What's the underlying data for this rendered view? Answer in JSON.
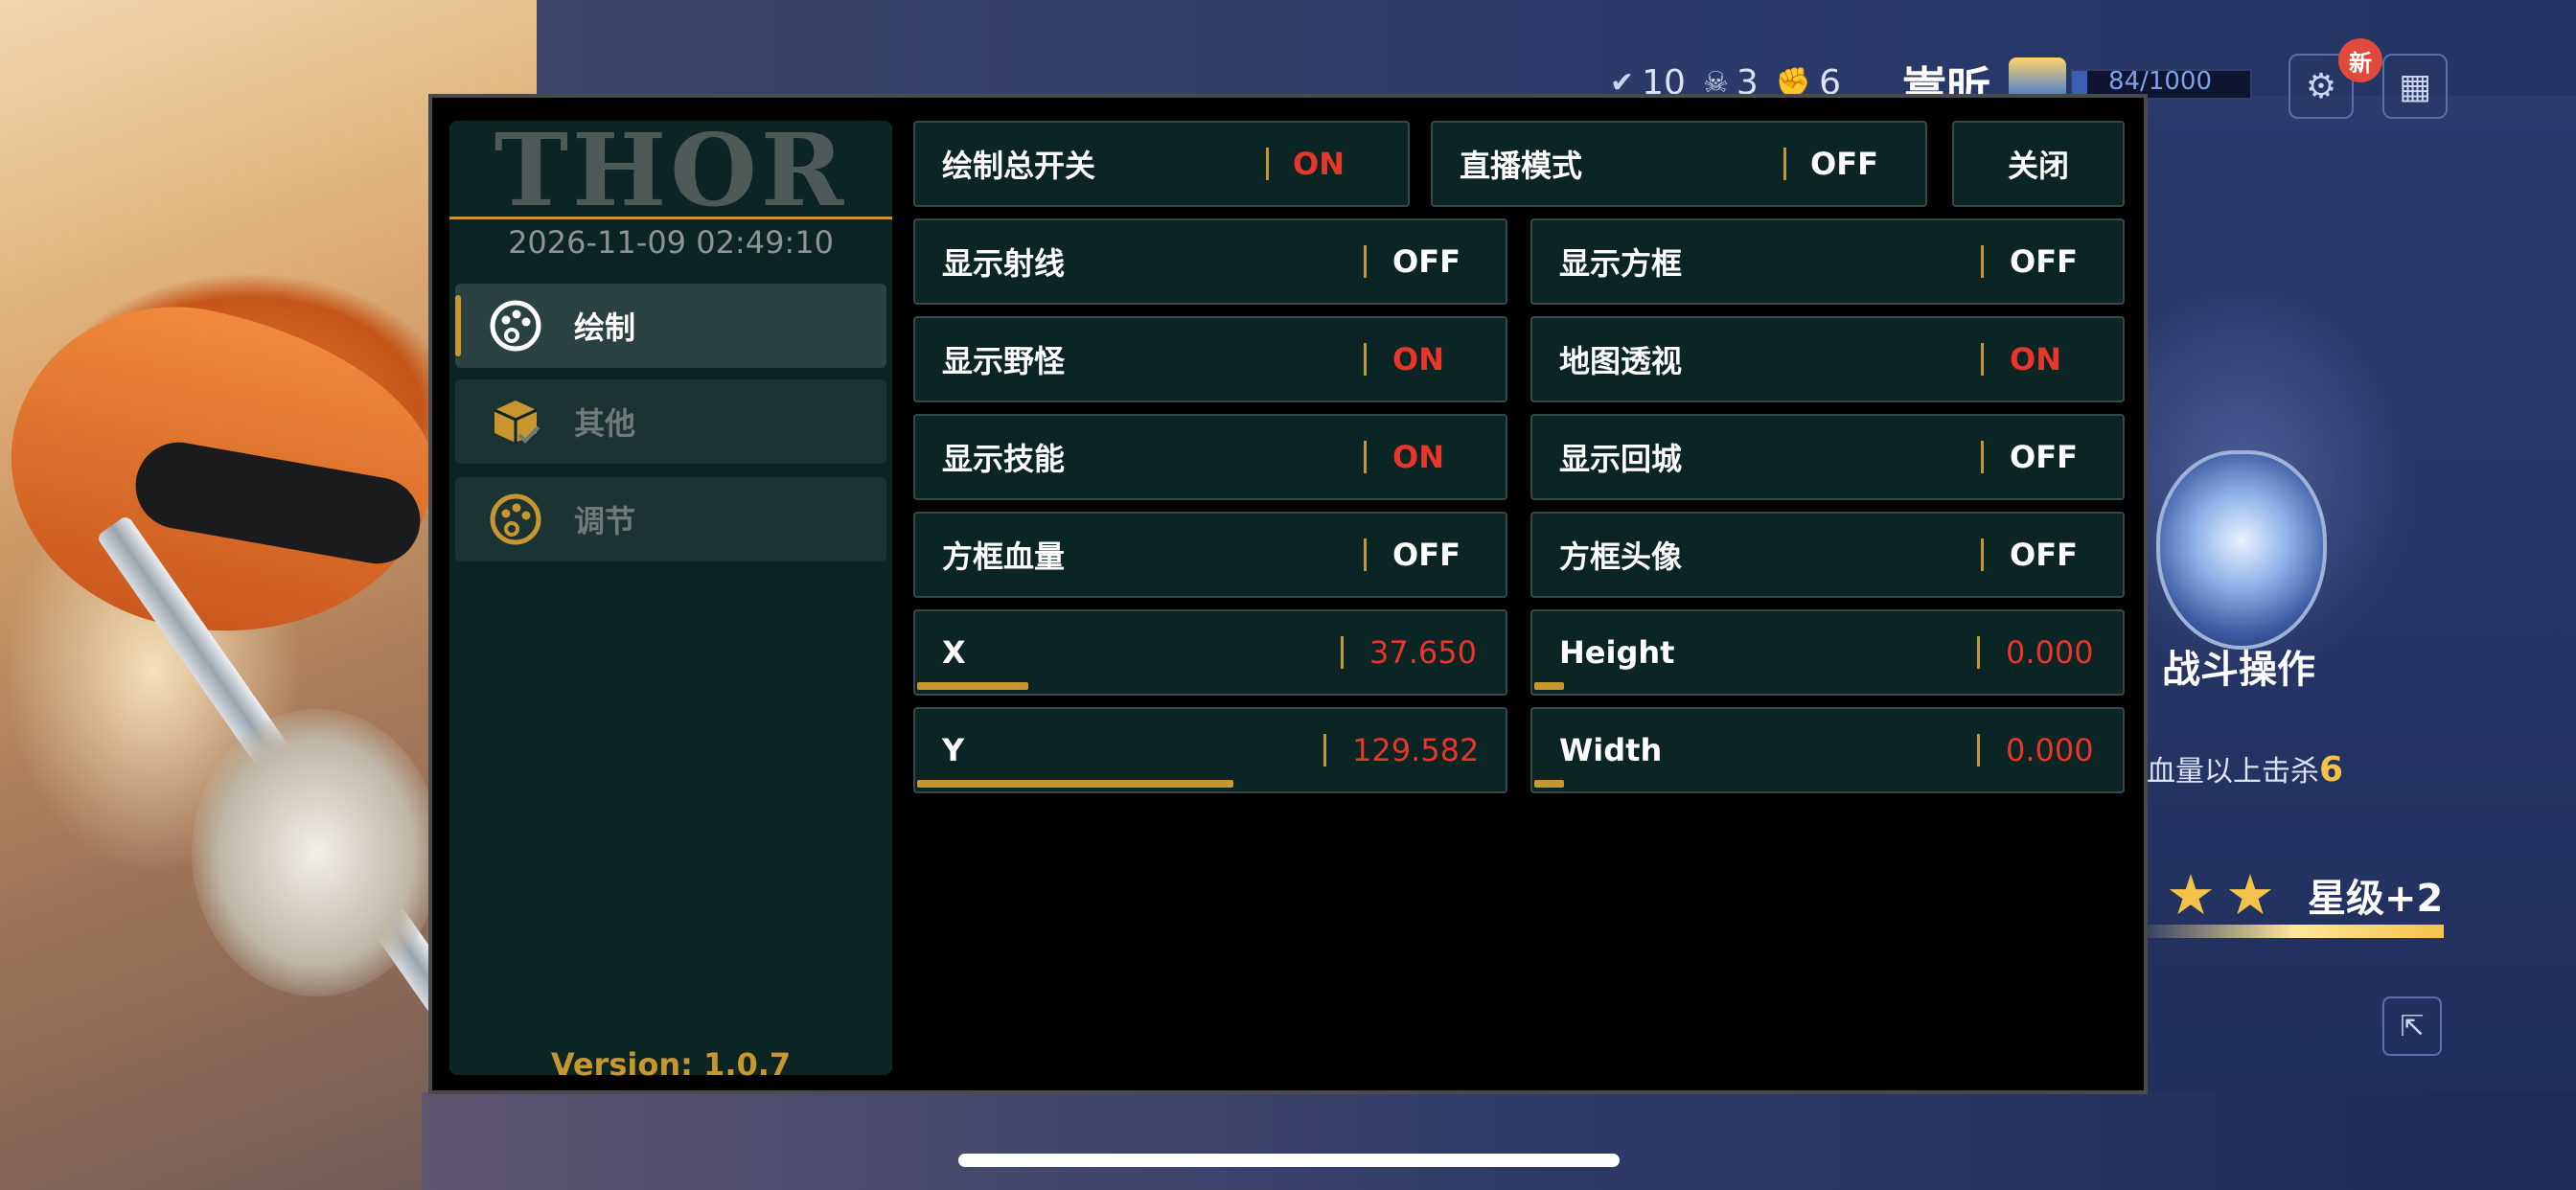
{
  "menu": {
    "logo": "THOR",
    "datetime": "2026-11-09 02:49:10",
    "version": "Version: 1.0.7",
    "nav": [
      {
        "label": "绘制",
        "icon": "palette-icon",
        "active": true
      },
      {
        "label": "其他",
        "icon": "box-check-icon",
        "active": false
      },
      {
        "label": "调节",
        "icon": "palette-icon",
        "active": false
      }
    ],
    "top_row": {
      "master": {
        "label": "绘制总开关",
        "value": "ON"
      },
      "stream": {
        "label": "直播模式",
        "value": "OFF"
      },
      "close_label": "关闭"
    },
    "toggles": [
      {
        "label": "显示射线",
        "value": "OFF"
      },
      {
        "label": "显示方框",
        "value": "OFF"
      },
      {
        "label": "显示野怪",
        "value": "ON"
      },
      {
        "label": "地图透视",
        "value": "ON"
      },
      {
        "label": "显示技能",
        "value": "ON"
      },
      {
        "label": "显示回城",
        "value": "OFF"
      },
      {
        "label": "方框血量",
        "value": "OFF"
      },
      {
        "label": "方框头像",
        "value": "OFF"
      }
    ],
    "sliders": [
      {
        "label": "X",
        "value": "37.650",
        "fraction": 0.19
      },
      {
        "label": "Height",
        "value": "0.000",
        "fraction": 0.05
      },
      {
        "label": "Y",
        "value": "129.582",
        "fraction": 0.54
      },
      {
        "label": "Width",
        "value": "0.000",
        "fraction": 0.05
      }
    ]
  },
  "game": {
    "stats": [
      {
        "icon": "check-icon",
        "value": "10"
      },
      {
        "icon": "skull-icon",
        "value": "3"
      },
      {
        "icon": "fist-icon",
        "value": "6"
      }
    ],
    "player_name": "嵩昕",
    "xp_text": "84/1000",
    "xp_fraction": 0.084,
    "new_badge": "新",
    "emblem_title": "战斗操作",
    "kill_text": "血量以上击杀",
    "kill_count": "6",
    "star_label": "星级+2"
  },
  "colors": {
    "accent": "#c8962e",
    "on": "#e8362a",
    "panel_bg": "#0b2424"
  }
}
